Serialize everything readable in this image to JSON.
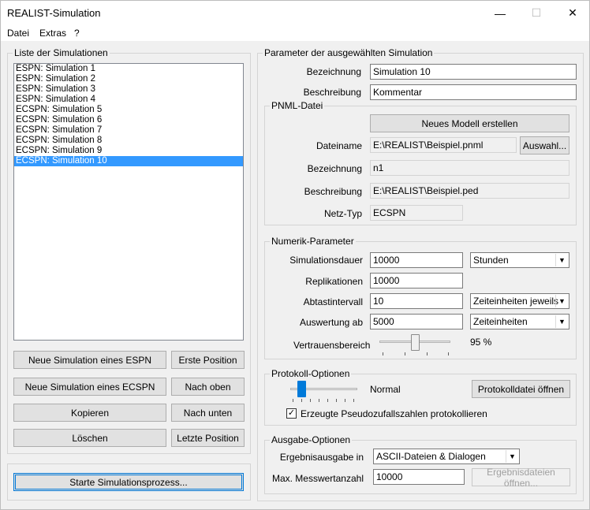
{
  "window": {
    "title": "REALIST-Simulation",
    "minimize_glyph": "—",
    "maximize_glyph": "☐",
    "close_glyph": "✕"
  },
  "menu": [
    "Datei",
    "Extras",
    "?"
  ],
  "sim_list": {
    "legend": "Liste der Simulationen",
    "items": [
      "ESPN: Simulation 1",
      "ESPN: Simulation 2",
      "ESPN: Simulation 3",
      "ESPN: Simulation 4",
      "ECSPN: Simulation 5",
      "ECSPN: Simulation 6",
      "ECSPN: Simulation 7",
      "ECSPN: Simulation 8",
      "ECSPN: Simulation 9",
      "ECSPN: Simulation 10"
    ],
    "selected_index": 9
  },
  "list_buttons": {
    "new_espn": "Neue Simulation eines ESPN",
    "first_position": "Erste Position",
    "new_ecspn": "Neue Simulation eines ECSPN",
    "move_up": "Nach oben",
    "copy": "Kopieren",
    "move_down": "Nach unten",
    "delete": "Löschen",
    "last_position": "Letzte Position"
  },
  "start_button": "Starte Simulationsprozess...",
  "params": {
    "legend": "Parameter der ausgewählten Simulation",
    "name_label": "Bezeichnung",
    "name_value": "Simulation 10",
    "desc_label": "Beschreibung",
    "desc_value": "Kommentar"
  },
  "pnml": {
    "legend": "PNML-Datei",
    "new_model_button": "Neues Modell erstellen",
    "filename_label": "Dateiname",
    "filename_value": "E:\\REALIST\\Beispiel.pnml",
    "browse_button": "Auswahl...",
    "name_label": "Bezeichnung",
    "name_value": "n1",
    "desc_label": "Beschreibung",
    "desc_value": "E:\\REALIST\\Beispiel.ped",
    "nettype_label": "Netz-Typ",
    "nettype_value": "ECSPN"
  },
  "numeric": {
    "legend": "Numerik-Parameter",
    "duration_label": "Simulationsdauer",
    "duration_value": "10000",
    "duration_unit": "Stunden",
    "replications_label": "Replikationen",
    "replications_value": "10000",
    "interval_label": "Abtastintervall",
    "interval_value": "10",
    "interval_unit": "Zeiteinheiten jeweils",
    "eval_label": "Auswertung ab",
    "eval_value": "5000",
    "eval_unit": "Zeiteinheiten",
    "confidence_label": "Vertrauensbereich",
    "confidence_value": "95 %",
    "confidence_level": 0.95
  },
  "protocol": {
    "legend": "Protokoll-Optionen",
    "level_label": "Normal",
    "open_log_button": "Protokolldatei öffnen",
    "checkbox_label": "Erzeugte Pseudozufallszahlen protokollieren",
    "checkbox_checked": true,
    "checkbox_mark": "✓"
  },
  "output": {
    "legend": "Ausgabe-Optionen",
    "result_label": "Ergebnisausgabe in",
    "result_value": "ASCII-Dateien & Dialogen",
    "max_label": "Max. Messwertanzahl",
    "max_value": "10000",
    "open_results_button": "Ergebnisdateien öffnen..."
  },
  "icons": {
    "dropdown": "▼"
  }
}
